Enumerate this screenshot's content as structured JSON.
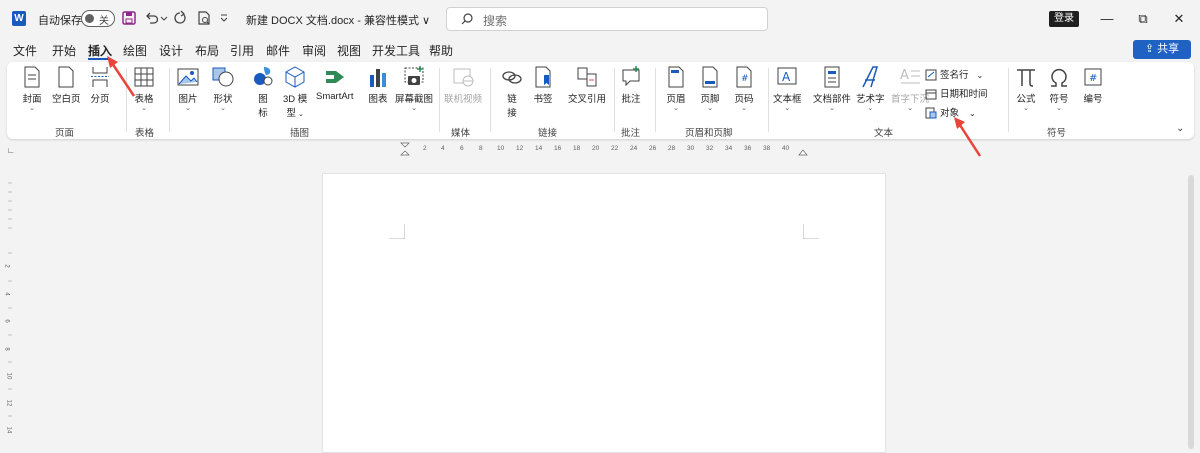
{
  "titlebar": {
    "app_logo": "W",
    "autosave_label": "自动保存",
    "autosave_state": "关",
    "doc_title": "新建 DOCX 文档.docx  -  兼容性模式 ∨",
    "search_placeholder": "搜索",
    "login_label": "登录",
    "minimize": "—",
    "restore": "⧉",
    "close": "✕"
  },
  "menu": {
    "tabs": [
      "文件",
      "开始",
      "插入",
      "绘图",
      "设计",
      "布局",
      "引用",
      "邮件",
      "审阅",
      "视图",
      "开发工具",
      "帮助"
    ],
    "active_tab": "插入",
    "share_label": "共享"
  },
  "ribbon": {
    "pages": {
      "cover": "封面",
      "blank": "空白页",
      "break": "分页",
      "group": "页面"
    },
    "table": {
      "table": "表格",
      "group": "表格"
    },
    "illustrations": {
      "picture": "图片",
      "shapes": "形状",
      "icons": "图",
      "icons2": "标",
      "model3d": "3D 模",
      "model3d2": "型",
      "smartart": "SmartArt",
      "chart": "图表",
      "screenshot": "屏幕截图",
      "group": "插图"
    },
    "media": {
      "video": "联机视频",
      "group": "媒体"
    },
    "links": {
      "link": "链",
      "link2": "接",
      "bookmark": "书签",
      "crossref": "交叉引用",
      "group": "链接"
    },
    "comments": {
      "comment": "批注",
      "group": "批注"
    },
    "header_footer": {
      "header": "页眉",
      "footer": "页脚",
      "page_number": "页码",
      "group": "页眉和页脚"
    },
    "text": {
      "textbox": "文本框",
      "quickparts": "文档部件",
      "wordart": "艺术字",
      "dropcap": "首字下沉",
      "signature": "签名行",
      "datetime": "日期和时间",
      "object": "对象",
      "group": "文本"
    },
    "symbols": {
      "equation": "公式",
      "symbol": "符号",
      "numbering": "编号",
      "group": "符号"
    }
  },
  "ruler": {
    "numbers": [
      "2",
      "4",
      "6",
      "8",
      "10",
      "12",
      "14",
      "16",
      "18",
      "20",
      "22",
      "24",
      "26",
      "28",
      "30",
      "32",
      "34",
      "36",
      "38",
      "40"
    ],
    "vertical_numbers": [
      "2",
      "4",
      "6",
      "8",
      "10",
      "12",
      "14"
    ]
  },
  "colors": {
    "accent": "#185abd",
    "annotation_arrow": "#e8443a"
  }
}
